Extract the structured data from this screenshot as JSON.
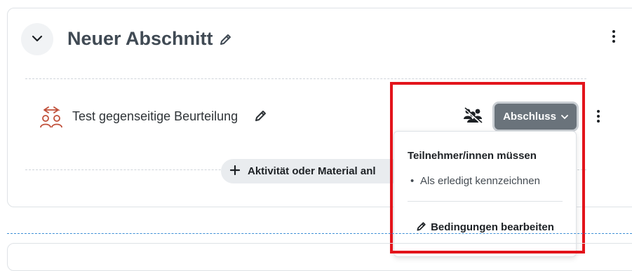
{
  "section": {
    "title": "Neuer Abschnitt",
    "collapse_icon": "chevron-down-icon",
    "edit_icon": "pencil-icon",
    "menu_icon": "kebab-icon"
  },
  "activity": {
    "name": "Test gegenseitige Beurteilung",
    "icon": "peer-assessment-icon",
    "edit_icon": "pencil-icon",
    "groups_icon": "groups-icon",
    "completion_button": "Abschluss",
    "menu_icon": "kebab-icon"
  },
  "add_button": {
    "label": "Aktivität oder Material anl",
    "icon": "plus-icon"
  },
  "completion_dropdown": {
    "heading": "Teilnehmer/innen müssen",
    "items": [
      "Als erledigt kennzeichnen"
    ],
    "edit_label": "Bedingungen bearbeiten"
  },
  "colors": {
    "highlight": "#e3141b",
    "completion_button_bg": "#6a737b",
    "activity_icon": "#c0503a"
  }
}
